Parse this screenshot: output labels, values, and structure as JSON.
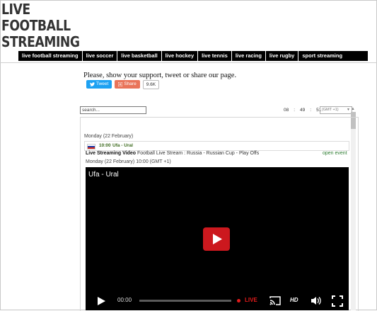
{
  "site": {
    "logo_line1": "LIVE FOOTBALL",
    "logo_line2": "STREAMING"
  },
  "nav": [
    {
      "label": "live football streaming"
    },
    {
      "label": "live soccer"
    },
    {
      "label": "live basketball"
    },
    {
      "label": "live hockey"
    },
    {
      "label": "live tennis"
    },
    {
      "label": "live racing"
    },
    {
      "label": "live rugby"
    },
    {
      "label": "sport streaming"
    }
  ],
  "support": {
    "text": "Please, show your support, tweet or share our page.",
    "tweet_label": "Tweet",
    "share_label": "Share",
    "share_count": "9.6K"
  },
  "search": {
    "value": "search..."
  },
  "clock": {
    "hours": "08",
    "sep1": ":",
    "minutes": "49",
    "sep2": ":",
    "seconds": "51",
    "timezone": "(GMT +1)"
  },
  "schedule": {
    "day_heading": "Monday (22 February)",
    "match": {
      "time": "10:00",
      "name": "Ufa - Ural"
    },
    "stream_label": "Live Streaming Video",
    "stream_desc": " Football Live Stream : Russia - Russian Cup - Play Offs",
    "open_event_label": "open event",
    "event_datetime": "Monday (22 February) 10:00 (GMT +1)"
  },
  "player": {
    "title": "Ufa - Ural",
    "time": "00:00",
    "live_label": "LIVE",
    "hd_label": "HD"
  },
  "colors": {
    "nav_bg": "#000000",
    "play_red": "#cc181e",
    "tweet_blue": "#1da1f2",
    "share_orange": "#e9745a",
    "live_red": "#e21b1b"
  }
}
